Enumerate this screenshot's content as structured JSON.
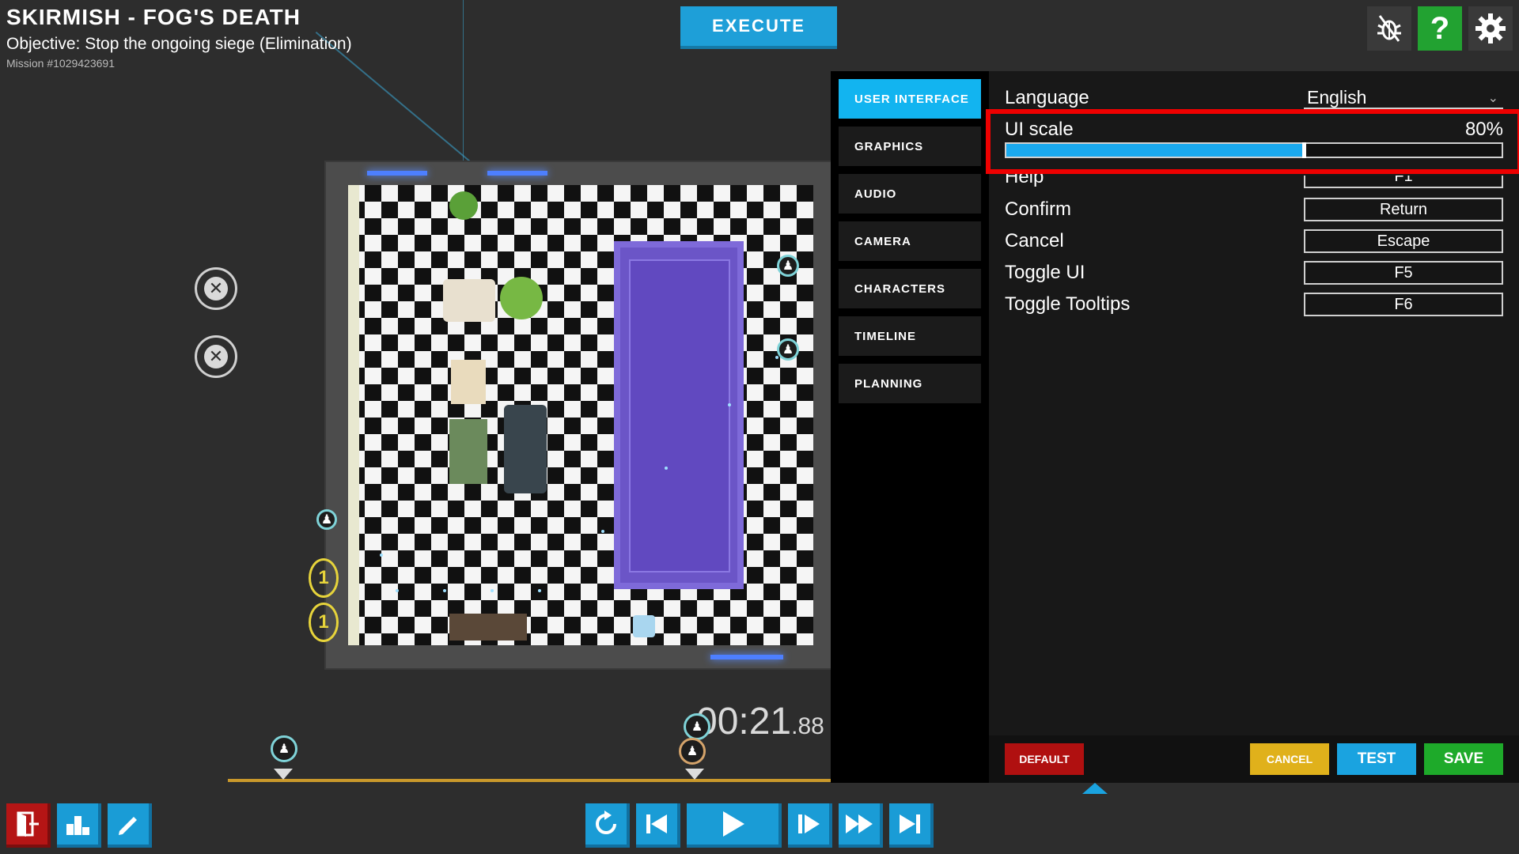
{
  "mission": {
    "title": "SKIRMISH - FOG'S DEATH",
    "objective": "Objective: Stop the ongoing siege (Elimination)",
    "id": "Mission #1029423691"
  },
  "toolbar": {
    "execute_label": "EXECUTE",
    "icons": [
      "bug-icon",
      "help-icon",
      "gear-icon"
    ],
    "help_glyph": "?"
  },
  "settings": {
    "tabs": [
      {
        "label": "USER INTERFACE",
        "active": true
      },
      {
        "label": "GRAPHICS",
        "active": false
      },
      {
        "label": "AUDIO",
        "active": false
      },
      {
        "label": "CAMERA",
        "active": false
      },
      {
        "label": "CHARACTERS",
        "active": false
      },
      {
        "label": "TIMELINE",
        "active": false
      },
      {
        "label": "PLANNING",
        "active": false
      }
    ],
    "language": {
      "label": "Language",
      "value": "English"
    },
    "ui_scale": {
      "label": "UI scale",
      "value_text": "80%",
      "fraction": 0.6
    },
    "keybinds": [
      {
        "label": "Help",
        "key": "F1"
      },
      {
        "label": "Confirm",
        "key": "Return"
      },
      {
        "label": "Cancel",
        "key": "Escape"
      },
      {
        "label": "Toggle UI",
        "key": "F5"
      },
      {
        "label": "Toggle Tooltips",
        "key": "F6"
      }
    ],
    "buttons": {
      "default": "DEFAULT",
      "cancel": "CANCEL",
      "test": "TEST",
      "save": "SAVE"
    },
    "accent_color": "#12b4f0",
    "highlight_color": "#ee0000"
  },
  "timeline": {
    "timer_main": "00:21",
    "timer_fraction": ".88"
  },
  "side_markers": {
    "count_glyph": "1"
  },
  "controls": {
    "left": [
      "exit-icon",
      "leaderboard-icon",
      "pencil-icon"
    ],
    "playback": [
      "rewind-icon",
      "skip-back-icon",
      "play-icon",
      "step-forward-icon",
      "fast-forward-icon",
      "skip-end-icon"
    ]
  }
}
